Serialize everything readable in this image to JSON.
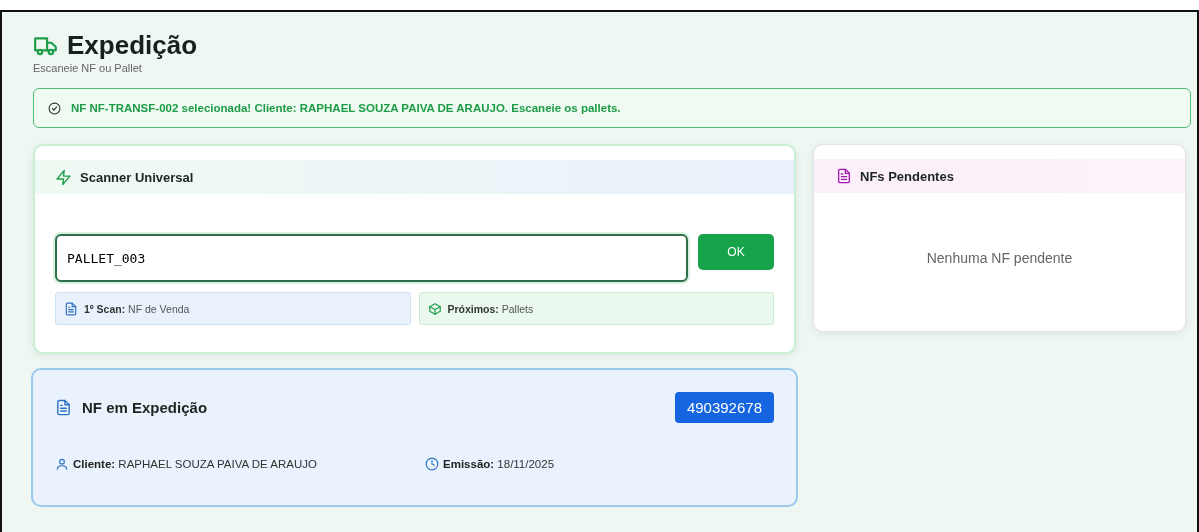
{
  "header": {
    "title": "Expedição",
    "subtitle": "Escaneie NF ou Pallet"
  },
  "alert": {
    "message": "NF NF-TRANSF-002 selecionada! Cliente: RAPHAEL SOUZA PAIVA DE ARAUJO. Escaneie os pallets."
  },
  "scanner": {
    "title": "Scanner Universal",
    "value": "PALLET_003",
    "button": "OK",
    "hints": [
      {
        "kind": "nf",
        "text": "**1º Scan:** NF de Venda"
      },
      {
        "kind": "pallet",
        "text": "**Próximos:** Pallets"
      }
    ]
  },
  "pending": {
    "title": "NFs Pendentes",
    "empty": "Nenhuma NF pendente"
  },
  "current_nf": {
    "title": "NF em Expedição",
    "number": "490392678",
    "details": [
      {
        "kind": "client",
        "text": "**Cliente:** RAPHAEL SOUZA PAIVA DE ARAUJO"
      },
      {
        "kind": "date",
        "text": "**Emissão:** 18/11/2025"
      }
    ]
  }
}
